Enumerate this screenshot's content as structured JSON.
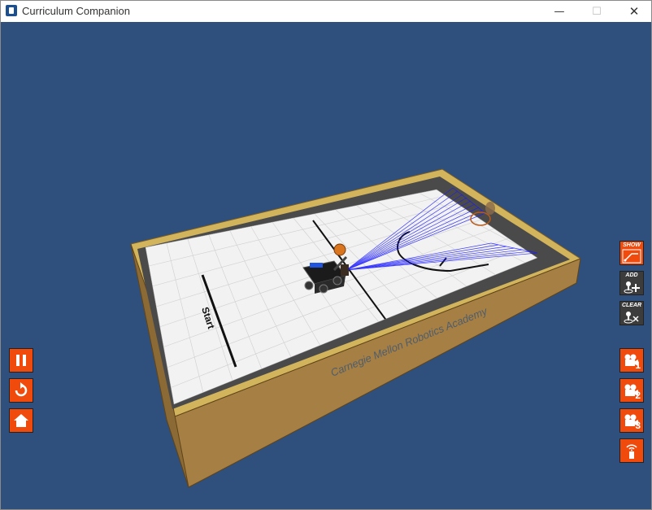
{
  "window": {
    "title": "Curriculum Companion"
  },
  "titlebar": {
    "minimize_glyph": "—",
    "maximize_glyph": "☐",
    "close_glyph": "✕"
  },
  "scene": {
    "start_label": "Start",
    "wall_brand": "Carnegie Mellon Robotics Academy",
    "background_color": "#2f4f7d"
  },
  "left_controls": [
    {
      "name": "pause-button",
      "icon": "pause-icon"
    },
    {
      "name": "reset-button",
      "icon": "reset-icon"
    },
    {
      "name": "home-button",
      "icon": "home-icon"
    }
  ],
  "right_controls": {
    "show": {
      "label": "SHOW",
      "icon": "show-path-icon"
    },
    "add": {
      "label": "ADD",
      "icon": "add-waypoint-icon"
    },
    "clear": {
      "label": "CLEAR",
      "icon": "clear-waypoint-icon"
    },
    "cameras": [
      {
        "number": "1",
        "icon": "camera-icon"
      },
      {
        "number": "2",
        "icon": "camera-icon"
      },
      {
        "number": "3",
        "icon": "camera-icon"
      }
    ],
    "remote": {
      "icon": "remote-control-icon"
    }
  },
  "colors": {
    "accent": "#f04a0c",
    "dark_button": "#3c3c3c",
    "sensor_beams": "#1a1aff"
  }
}
